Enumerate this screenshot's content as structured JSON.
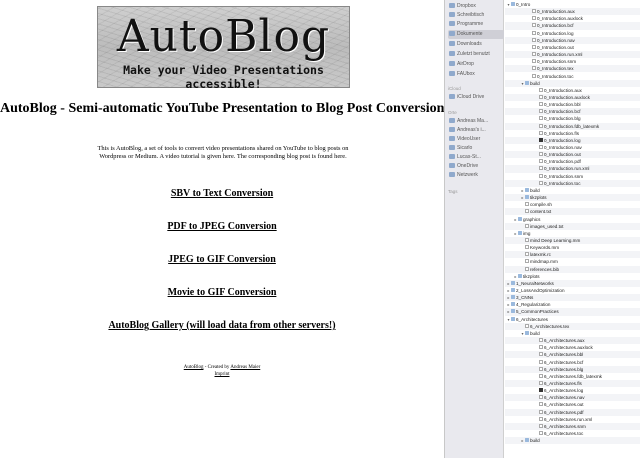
{
  "webpage": {
    "logo": {
      "title": "AutoBlog",
      "subtitle": "Make your Video Presentations accessible!"
    },
    "heading": "AutoBlog - Semi-automatic YouTube Presentation to Blog Post Conversion",
    "intro": "This is AutoBlog, a set of tools to convert video presentations shared on YouTube to blog posts on Wordpress or Medium. A video tutorial is given here. The corresponding blog post is found here.",
    "links": [
      "SBV to Text Conversion",
      "PDF to JPEG Conversion",
      "JPEG to GIF Conversion",
      "Movie to GIF Conversion",
      "AutoBlog Gallery (will load data from other servers!)"
    ],
    "footer": {
      "brand": "AutoBlog",
      "created_by": " - Created by ",
      "author": "Andreas Maier",
      "imprint": "Imprint"
    }
  },
  "sidebar": {
    "items": [
      "Dropbox",
      "Schreibtisch",
      "Programme",
      "Dokumente",
      "Downloads",
      "Zuletzt benutzt",
      "AirDrop",
      "FAUbox"
    ],
    "selected_index": 3,
    "header_icloud": "iCloud",
    "icloud_items": [
      "iCloud Drive"
    ],
    "header_orte": "Orte",
    "places": [
      "Andreas Ma...",
      "Andreas's i...",
      "VideoUser",
      "Sicarlo",
      "Lucas-St...",
      "OneDrive",
      "Netzwerk"
    ],
    "header_tags": "Tags"
  },
  "filelist": {
    "rows": [
      {
        "indent": 0,
        "tri": "▾",
        "kind": "folder",
        "name": "0_Intro"
      },
      {
        "indent": 3,
        "tri": "",
        "kind": "file",
        "name": "0_Introduction.aux"
      },
      {
        "indent": 3,
        "tri": "",
        "kind": "file",
        "name": "0_Introduction.auxlock"
      },
      {
        "indent": 3,
        "tri": "",
        "kind": "file",
        "name": "0_Introduction.bcf"
      },
      {
        "indent": 3,
        "tri": "",
        "kind": "file",
        "name": "0_Introduction.log"
      },
      {
        "indent": 3,
        "tri": "",
        "kind": "file",
        "name": "0_Introduction.nav"
      },
      {
        "indent": 3,
        "tri": "",
        "kind": "file",
        "name": "0_Introduction.out"
      },
      {
        "indent": 3,
        "tri": "",
        "kind": "file",
        "name": "0_Introduction.run.xml"
      },
      {
        "indent": 3,
        "tri": "",
        "kind": "file",
        "name": "0_Introduction.snm"
      },
      {
        "indent": 3,
        "tri": "",
        "kind": "file",
        "name": "0_Introduction.tex"
      },
      {
        "indent": 3,
        "tri": "",
        "kind": "file",
        "name": "0_Introduction.toc"
      },
      {
        "indent": 2,
        "tri": "▾",
        "kind": "folder",
        "name": "build"
      },
      {
        "indent": 4,
        "tri": "",
        "kind": "file",
        "name": "0_Introduction.aux"
      },
      {
        "indent": 4,
        "tri": "",
        "kind": "file",
        "name": "0_Introduction.auxlock"
      },
      {
        "indent": 4,
        "tri": "",
        "kind": "file",
        "name": "0_Introduction.bbl"
      },
      {
        "indent": 4,
        "tri": "",
        "kind": "file",
        "name": "0_Introduction.bcf"
      },
      {
        "indent": 4,
        "tri": "",
        "kind": "file",
        "name": "0_Introduction.blg"
      },
      {
        "indent": 4,
        "tri": "",
        "kind": "file",
        "name": "0_Introduction.fdb_latexmk"
      },
      {
        "indent": 4,
        "tri": "",
        "kind": "file",
        "name": "0_Introduction.fls"
      },
      {
        "indent": 4,
        "tri": "",
        "kind": "dark",
        "name": "0_Introduction.log"
      },
      {
        "indent": 4,
        "tri": "",
        "kind": "file",
        "name": "0_Introduction.nav"
      },
      {
        "indent": 4,
        "tri": "",
        "kind": "file",
        "name": "0_Introduction.out"
      },
      {
        "indent": 4,
        "tri": "",
        "kind": "file",
        "name": "0_Introduction.pdf"
      },
      {
        "indent": 4,
        "tri": "",
        "kind": "file",
        "name": "0_Introduction.run.xml"
      },
      {
        "indent": 4,
        "tri": "",
        "kind": "file",
        "name": "0_Introduction.snm"
      },
      {
        "indent": 4,
        "tri": "",
        "kind": "file",
        "name": "0_Introduction.toc"
      },
      {
        "indent": 2,
        "tri": "▸",
        "kind": "folder",
        "name": "build"
      },
      {
        "indent": 2,
        "tri": "▸",
        "kind": "folder",
        "name": "tikzplots"
      },
      {
        "indent": 2,
        "tri": "",
        "kind": "file",
        "name": "compile.sh"
      },
      {
        "indent": 2,
        "tri": "",
        "kind": "file",
        "name": "content.txt"
      },
      {
        "indent": 1,
        "tri": "▸",
        "kind": "folder",
        "name": "graphics"
      },
      {
        "indent": 2,
        "tri": "",
        "kind": "file",
        "name": "images_used.txt"
      },
      {
        "indent": 1,
        "tri": "▸",
        "kind": "folder",
        "name": "img"
      },
      {
        "indent": 2,
        "tri": "",
        "kind": "file",
        "name": "mind Deep Learning.mm"
      },
      {
        "indent": 2,
        "tri": "",
        "kind": "file",
        "name": "Keywords.mm"
      },
      {
        "indent": 2,
        "tri": "",
        "kind": "file",
        "name": "latexmk.rc"
      },
      {
        "indent": 2,
        "tri": "",
        "kind": "file",
        "name": "mindmap.mm"
      },
      {
        "indent": 2,
        "tri": "",
        "kind": "file",
        "name": "references.bib"
      },
      {
        "indent": 1,
        "tri": "▸",
        "kind": "folder",
        "name": "tikzplots"
      },
      {
        "indent": 0,
        "tri": "▸",
        "kind": "folder",
        "name": "1_NeuralNetworks"
      },
      {
        "indent": 0,
        "tri": "▸",
        "kind": "folder",
        "name": "2_LossAndOptimization"
      },
      {
        "indent": 0,
        "tri": "▸",
        "kind": "folder",
        "name": "3_CNNs"
      },
      {
        "indent": 0,
        "tri": "▸",
        "kind": "folder",
        "name": "4_Regularization"
      },
      {
        "indent": 0,
        "tri": "▸",
        "kind": "folder",
        "name": "5_CommonPractices"
      },
      {
        "indent": 0,
        "tri": "▾",
        "kind": "folder",
        "name": "6_Architectures"
      },
      {
        "indent": 2,
        "tri": "",
        "kind": "file",
        "name": "6_Architectures.tex"
      },
      {
        "indent": 2,
        "tri": "▾",
        "kind": "folder",
        "name": "build"
      },
      {
        "indent": 4,
        "tri": "",
        "kind": "file",
        "name": "6_Architectures.aux"
      },
      {
        "indent": 4,
        "tri": "",
        "kind": "file",
        "name": "6_Architectures.auxlock"
      },
      {
        "indent": 4,
        "tri": "",
        "kind": "file",
        "name": "6_Architectures.bbl"
      },
      {
        "indent": 4,
        "tri": "",
        "kind": "file",
        "name": "6_Architectures.bcf"
      },
      {
        "indent": 4,
        "tri": "",
        "kind": "file",
        "name": "6_Architectures.blg"
      },
      {
        "indent": 4,
        "tri": "",
        "kind": "file",
        "name": "6_Architectures.fdb_latexmk"
      },
      {
        "indent": 4,
        "tri": "",
        "kind": "file",
        "name": "6_Architectures.fls"
      },
      {
        "indent": 4,
        "tri": "",
        "kind": "dark",
        "name": "6_Architectures.log"
      },
      {
        "indent": 4,
        "tri": "",
        "kind": "file",
        "name": "6_Architectures.nav"
      },
      {
        "indent": 4,
        "tri": "",
        "kind": "file",
        "name": "6_Architectures.out"
      },
      {
        "indent": 4,
        "tri": "",
        "kind": "file",
        "name": "6_Architectures.pdf"
      },
      {
        "indent": 4,
        "tri": "",
        "kind": "file",
        "name": "6_Architectures.run.xml"
      },
      {
        "indent": 4,
        "tri": "",
        "kind": "file",
        "name": "6_Architectures.snm"
      },
      {
        "indent": 4,
        "tri": "",
        "kind": "file",
        "name": "6_Architectures.toc"
      },
      {
        "indent": 2,
        "tri": "▸",
        "kind": "folder",
        "name": "build"
      }
    ]
  },
  "colors": {
    "folder_icon": "#9ab9dd",
    "sidebar_bg": "#e9e9ee",
    "selected_bg": "#cfcfd6"
  }
}
